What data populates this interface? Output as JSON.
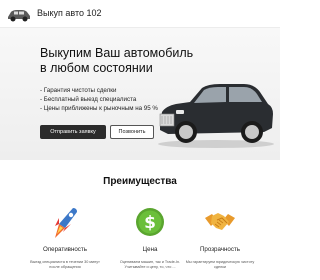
{
  "header": {
    "brand": "Выкуп авто 102"
  },
  "hero": {
    "title": "Выкупим Ваш автомобиль в любом состоянии",
    "features": [
      "- Гарантия чистоты сделки",
      "- Бесплатный выезд специалиста",
      "- Цены приближены к рыночным на 95 %"
    ],
    "primary_button": "Отправить заявку",
    "secondary_button": "Позвонить"
  },
  "advantages": {
    "title": "Преимущества",
    "items": [
      {
        "title": "Оперативность",
        "text": "Выезд специалиста в течении 30 минут после обращения",
        "icon": "rocket-icon"
      },
      {
        "title": "Цена",
        "text": "Оцениваем машин, так и Trade-In. Учитывайте и цену, то, что ...",
        "icon": "dollar-coin-icon"
      },
      {
        "title": "Прозрачность",
        "text": "Мы гарантируем юридическую чистоту сделки",
        "icon": "handshake-icon"
      }
    ]
  },
  "colors": {
    "primary_button_bg": "#2b2b2b",
    "coin": "#6bbf3a",
    "handshake": "#f0b441",
    "rocket_body": "#3c78c8",
    "flame": "#f26a2d"
  }
}
